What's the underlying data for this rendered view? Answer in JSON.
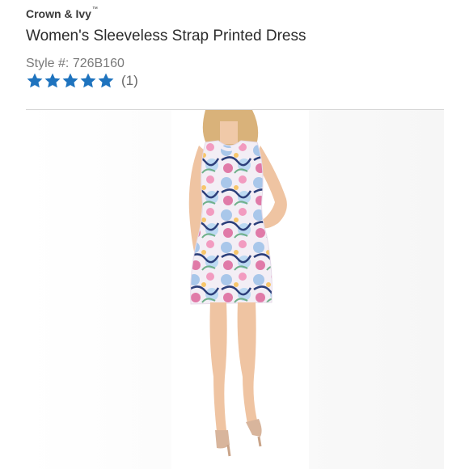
{
  "product": {
    "brand": "Crown & Ivy",
    "brand_mark": "™",
    "title": "Women's Sleeveless Strap Printed Dress",
    "style_label": "Style #:",
    "style_number": "726B160",
    "rating": {
      "stars": 5,
      "max": 5,
      "count_text": "(1)"
    }
  },
  "colors": {
    "star": "#1e73be",
    "divider": "#d6d6d6",
    "text_dark": "#2b2b2b",
    "text_muted": "#7a7a7a"
  },
  "image": {
    "icon": "product-photo-model-in-floral-dress"
  }
}
